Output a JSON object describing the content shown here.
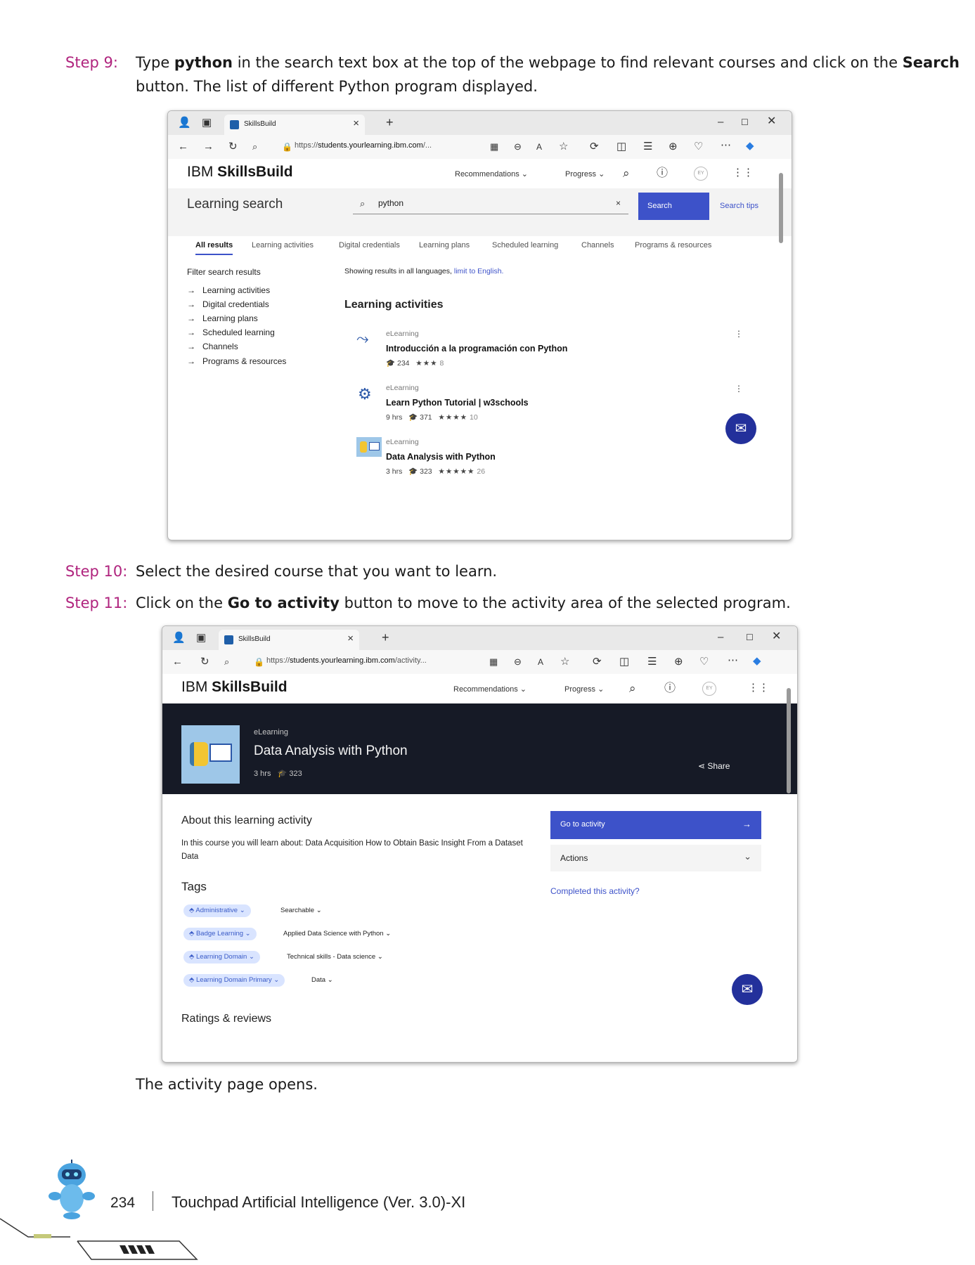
{
  "step9": {
    "num": "Step 9:",
    "t1": "Type ",
    "b1": "python",
    "t2": " in the search text box at the top of the webpage to find relevant courses and click on the ",
    "b2": "Search",
    "t3": " button. The list of different Python program displayed."
  },
  "step10": {
    "num": "Step 10:",
    "text": "Select the desired course that you want to learn."
  },
  "step11": {
    "num": "Step 11:",
    "t1": "Click on the ",
    "b1": "Go to activity",
    "t2": " button to move to the activity area of the selected program."
  },
  "closing_text": "The activity page opens.",
  "browser1": {
    "tab_title": "SkillsBuild",
    "url_prefix": "https://",
    "url_host": "students.yourlearning.ibm.com",
    "url_rest": "/...",
    "brand_light": "IBM ",
    "brand_bold": "SkillsBuild",
    "nav": {
      "recommendations": "Recommendations",
      "progress": "Progress",
      "avatar": "EY"
    },
    "search_title": "Learning search",
    "search_value": "python",
    "search_button": "Search",
    "search_tips": "Search tips",
    "tabs": [
      "All results",
      "Learning activities",
      "Digital credentials",
      "Learning plans",
      "Scheduled learning",
      "Channels",
      "Programs & resources"
    ],
    "filter_title": "Filter search results",
    "filters": [
      "Learning activities",
      "Digital credentials",
      "Learning plans",
      "Scheduled learning",
      "Channels",
      "Programs & resources"
    ],
    "notice": "Showing results in all languages,",
    "notice_link": "limit to English.",
    "section_title": "Learning activities",
    "results": [
      {
        "type": "eLearning",
        "title": "Introducción a la programación con Python",
        "hours": "",
        "learners": "234",
        "stars": "★★★",
        "reviews": "8"
      },
      {
        "type": "eLearning",
        "title": "Learn Python Tutorial | w3schools",
        "hours": "9 hrs",
        "learners": "371",
        "stars": "★★★★",
        "reviews": "10"
      },
      {
        "type": "eLearning",
        "title": "Data Analysis with Python",
        "hours": "3 hrs",
        "learners": "323",
        "stars": "★★★★★",
        "reviews": "26"
      }
    ]
  },
  "browser2": {
    "tab_title": "SkillsBuild",
    "url_prefix": "https://",
    "url_host": "students.yourlearning.ibm.com",
    "url_rest": "/activity...",
    "brand_light": "IBM ",
    "brand_bold": "SkillsBuild",
    "nav": {
      "recommendations": "Recommendations",
      "progress": "Progress",
      "avatar": "EY"
    },
    "hero_type": "eLearning",
    "hero_title": "Data Analysis with Python",
    "hero_hours": "3 hrs",
    "hero_learners": "323",
    "share": "Share",
    "about_title": "About this learning activity",
    "about_text": "In this course you will learn about: Data Acquisition How to Obtain Basic Insight From a Dataset Data",
    "go_button": "Go to activity",
    "actions": "Actions",
    "completed_link": "Completed this activity?",
    "tags_title": "Tags",
    "tags": [
      {
        "key": "Administrative",
        "value": "Searchable"
      },
      {
        "key": "Badge Learning",
        "value": "Applied Data Science with Python"
      },
      {
        "key": "Learning Domain",
        "value": "Technical skills - Data science"
      },
      {
        "key": "Learning Domain Primary",
        "value": "Data"
      }
    ],
    "ratings_title": "Ratings & reviews"
  },
  "footer": {
    "page_number": "234",
    "book_title": "Touchpad Artificial Intelligence (Ver. 3.0)-XI"
  },
  "colors": {
    "step_label": "#b0247e",
    "ibm_blue": "#3d52c9",
    "hero_bg": "#161a26",
    "chat_button": "#23309b"
  }
}
